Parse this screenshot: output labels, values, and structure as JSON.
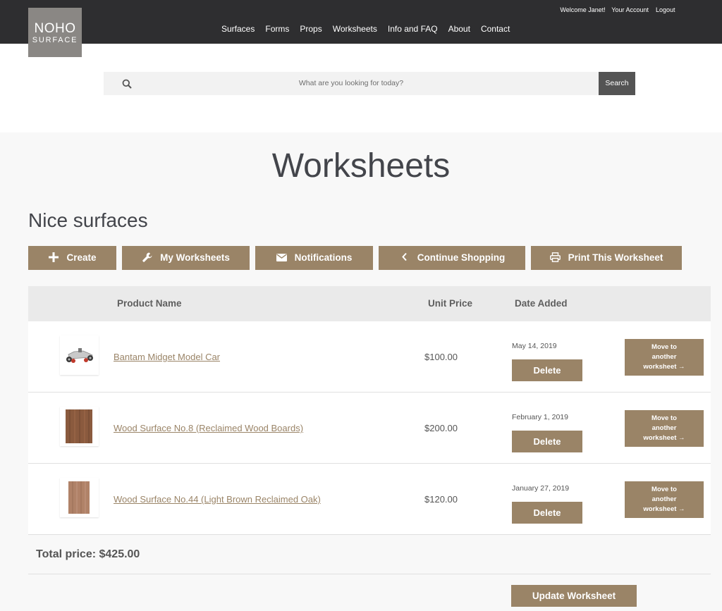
{
  "brand": {
    "line1": "NOHO",
    "line2": "SURFACE"
  },
  "account": {
    "welcome": "Welcome Janet!",
    "your_account": "Your Account",
    "logout": "Logout"
  },
  "nav": [
    "Surfaces",
    "Forms",
    "Props",
    "Worksheets",
    "Info and FAQ",
    "About",
    "Contact"
  ],
  "search": {
    "placeholder": "What are you looking for today?",
    "button": "Search"
  },
  "page_title": "Worksheets",
  "worksheet_name": "Nice surfaces",
  "actions": [
    {
      "label": "Create",
      "icon": "plus-icon"
    },
    {
      "label": "My Worksheets",
      "icon": "wrench-icon"
    },
    {
      "label": "Notifications",
      "icon": "envelope-icon"
    },
    {
      "label": "Continue Shopping",
      "icon": "chevron-left-icon"
    },
    {
      "label": "Print This Worksheet",
      "icon": "printer-icon"
    }
  ],
  "table": {
    "headers": {
      "product": "Product Name",
      "price": "Unit Price",
      "date": "Date Added"
    },
    "rows": [
      {
        "name": "Bantam Midget Model Car",
        "price": "$100.00",
        "date": "May 14, 2019",
        "delete": "Delete",
        "move": [
          "Move to",
          "another",
          "worksheet →"
        ]
      },
      {
        "name": "Wood Surface No.8 (Reclaimed Wood Boards)",
        "price": "$200.00",
        "date": "February 1, 2019",
        "delete": "Delete",
        "move": [
          "Move to",
          "another",
          "worksheet →"
        ]
      },
      {
        "name": "Wood Surface No.44 (Light Brown Reclaimed Oak)",
        "price": "$120.00",
        "date": "January 27, 2019",
        "delete": "Delete",
        "move": [
          "Move to",
          "another",
          "worksheet →"
        ]
      }
    ]
  },
  "total": "Total price: $425.00",
  "update_button": "Update Worksheet",
  "colors": {
    "accent": "#9a8467",
    "header_bg": "#2e2e30"
  }
}
